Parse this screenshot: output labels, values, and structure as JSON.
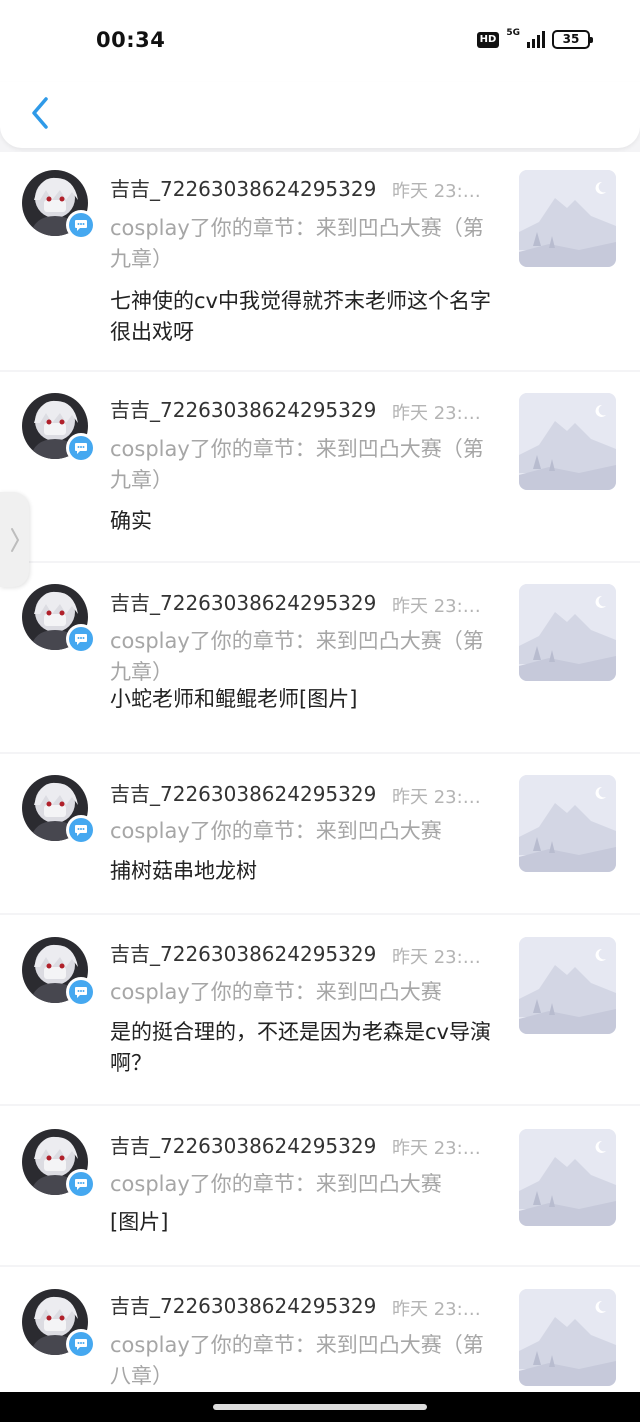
{
  "status_bar": {
    "time": "00:34",
    "hd_label": "HD",
    "network_label": "5G",
    "battery": "35"
  },
  "header": {
    "back_icon": "chevron-left-icon"
  },
  "notifications": [
    {
      "username": "吉吉_72263038624295329",
      "time": "昨天 23:…",
      "action": "cosplay了你的章节：来到凹凸大赛（第九章）",
      "comment": "七神使的cv中我觉得就芥末老师这个名字很出戏呀"
    },
    {
      "username": "吉吉_72263038624295329",
      "time": "昨天 23:…",
      "action": "cosplay了你的章节：来到凹凸大赛（第九章）",
      "comment": "确实"
    },
    {
      "username": "吉吉_72263038624295329",
      "time": "昨天 23:…",
      "action": "cosplay了你的章节：来到凹凸大赛（第九章）",
      "comment": "小蛇老师和鲲鲲老师[图片]"
    },
    {
      "username": "吉吉_72263038624295329",
      "time": "昨天 23:…",
      "action": "cosplay了你的章节：来到凹凸大赛",
      "comment": "捕树菇串地龙树"
    },
    {
      "username": "吉吉_72263038624295329",
      "time": "昨天 23:…",
      "action": "cosplay了你的章节：来到凹凸大赛",
      "comment": "是的挺合理的，不还是因为老森是cv导演啊？"
    },
    {
      "username": "吉吉_72263038624295329",
      "time": "昨天 23:…",
      "action": "cosplay了你的章节：来到凹凸大赛",
      "comment": "[图片]"
    },
    {
      "username": "吉吉_72263038624295329",
      "time": "昨天 23:…",
      "action": "cosplay了你的章节：来到凹凸大赛（第八章）",
      "comment": ""
    }
  ],
  "colors": {
    "accent": "#45a8f0",
    "muted_text": "#a6a6a6",
    "background": "#f4f4f6"
  }
}
